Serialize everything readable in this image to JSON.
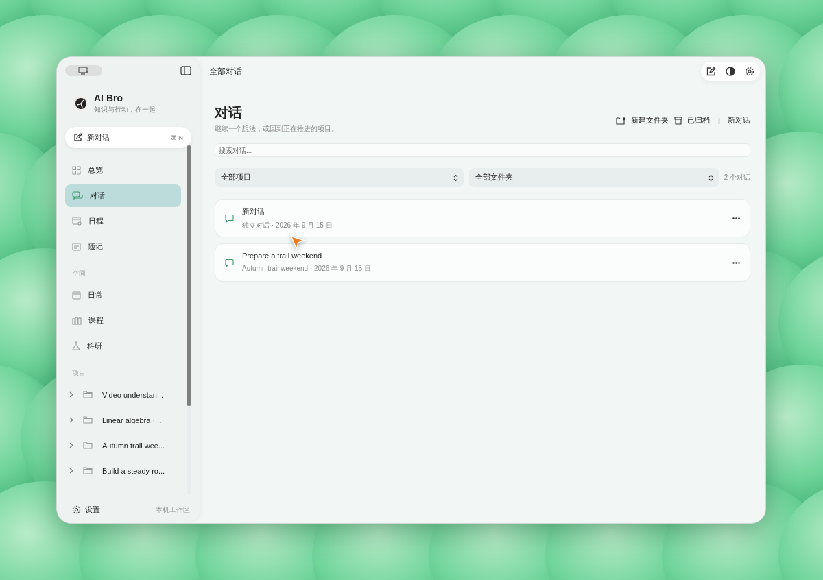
{
  "window": {
    "title": "全部对话"
  },
  "sidebar": {
    "app_name": "AI Bro",
    "tagline": "知识与行动，在一起",
    "new_chat": {
      "label": "新对话",
      "shortcut": "⌘ N"
    },
    "nav": [
      {
        "label": "总览",
        "selected": false
      },
      {
        "label": "对话",
        "selected": true
      },
      {
        "label": "日程",
        "selected": false
      },
      {
        "label": "随记",
        "selected": false
      }
    ],
    "spaces_heading": "空间",
    "spaces": [
      {
        "label": "日常"
      },
      {
        "label": "课程"
      },
      {
        "label": "科研"
      }
    ],
    "projects_heading": "项目",
    "projects": [
      {
        "name": "Video understan...",
        "expanded": false
      },
      {
        "name": "Linear algebra ·...",
        "expanded": false
      },
      {
        "name": "Autumn trail wee...",
        "expanded": false
      },
      {
        "name": "Build a steady ro...",
        "expanded": false
      }
    ],
    "settings_label": "设置",
    "workspace_label": "本机工作区"
  },
  "main": {
    "heading": "对话",
    "subtitle": "继续一个想法，或回到正在推进的项目。",
    "actions": [
      {
        "label": "新建文件夹"
      },
      {
        "label": "已归档"
      },
      {
        "label": "新对话"
      }
    ],
    "search": {
      "placeholder": "搜索对话..."
    },
    "filters": [
      {
        "label": "全部项目"
      },
      {
        "label": "全部文件夹"
      }
    ],
    "count": "2 个对话",
    "conversations": [
      {
        "title": "新对话",
        "meta": "独立对话 · 2026 年 9 月 15 日"
      },
      {
        "title": "Prepare a trail weekend",
        "meta": "Autumn trail weekend · 2026 年 9 月 15 日"
      }
    ]
  }
}
